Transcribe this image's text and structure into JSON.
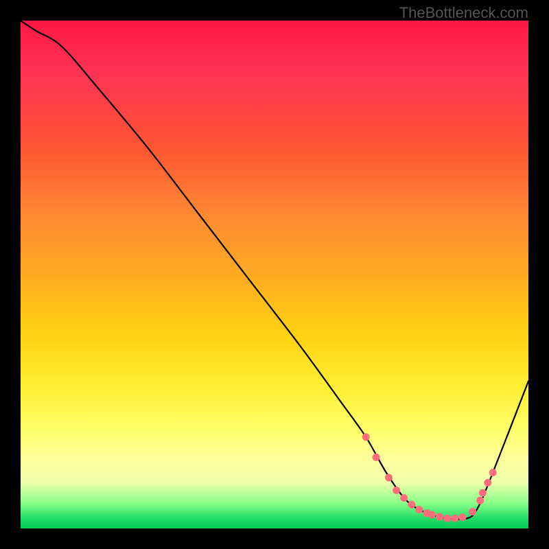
{
  "attribution": "TheBottleneck.com",
  "chart_data": {
    "type": "line",
    "title": "",
    "xlabel": "",
    "ylabel": "",
    "x_range": [
      0,
      100
    ],
    "y_range": [
      0,
      100
    ],
    "series": [
      {
        "name": "bottleneck-curve",
        "x": [
          0,
          3,
          8,
          15,
          25,
          35,
          45,
          55,
          63,
          68,
          72,
          76,
          80,
          84,
          88,
          90,
          93,
          100
        ],
        "y": [
          100,
          98,
          95,
          87,
          75,
          62,
          49,
          36,
          25,
          18,
          11,
          5.5,
          3,
          2,
          2,
          4,
          11,
          29
        ]
      }
    ],
    "markers": {
      "name": "highlight-dots",
      "color": "#ff6e7a",
      "x": [
        68,
        70,
        72.5,
        74,
        75.5,
        77,
        78.5,
        80,
        81,
        82.5,
        84,
        85.5,
        87,
        89,
        90.5,
        91,
        92,
        93
      ],
      "y": [
        18,
        14,
        10,
        7.5,
        6,
        4.7,
        3.7,
        3,
        2.7,
        2.3,
        2,
        2,
        2.2,
        3.3,
        5.5,
        7,
        9,
        11
      ]
    }
  }
}
